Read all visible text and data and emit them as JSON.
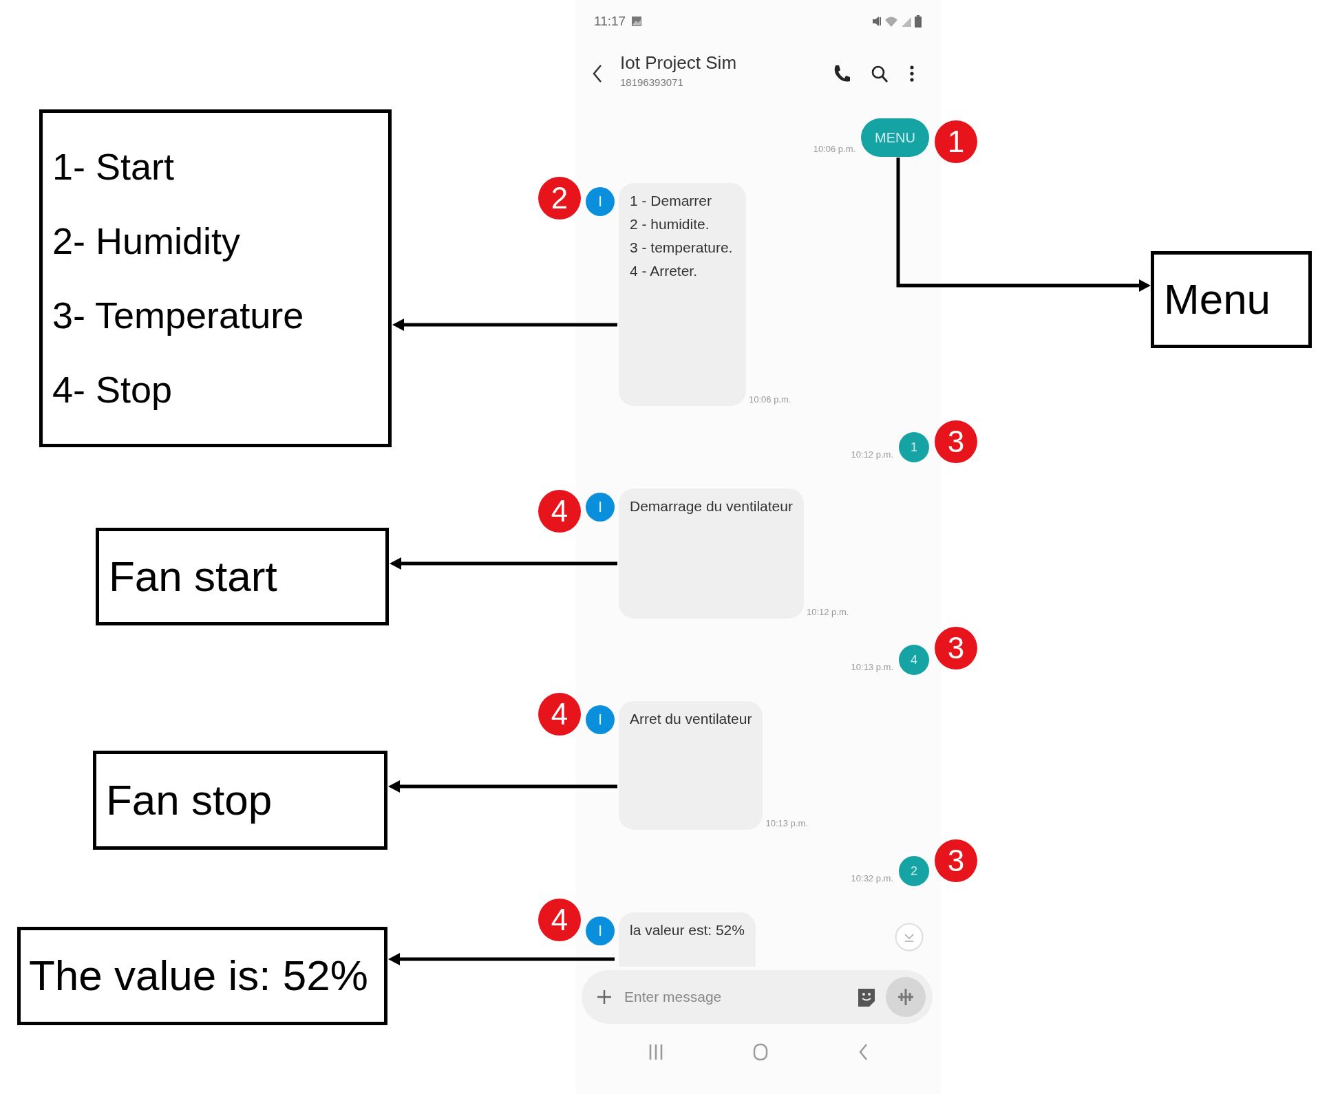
{
  "status_bar": {
    "time": "11:17"
  },
  "conversation": {
    "title": "Iot Project Sim",
    "number": "18196393071"
  },
  "messages": [
    {
      "kind": "sent",
      "text": "MENU",
      "time": "10:06 p.m."
    },
    {
      "kind": "received",
      "avatar": "I",
      "lines": [
        "1 - Demarrer",
        "2 - humidite.",
        "3 - temperature.",
        "4 - Arreter."
      ],
      "time": "10:06 p.m."
    },
    {
      "kind": "sent",
      "text": "1",
      "time": "10:12 p.m."
    },
    {
      "kind": "received",
      "avatar": "I",
      "lines": [
        "Demarrage du ventilateur"
      ],
      "time": "10:12 p.m."
    },
    {
      "kind": "sent",
      "text": "4",
      "time": "10:13 p.m."
    },
    {
      "kind": "received",
      "avatar": "I",
      "lines": [
        "Arret du ventilateur"
      ],
      "time": "10:13 p.m."
    },
    {
      "kind": "sent",
      "text": "2",
      "time": "10:32 p.m."
    },
    {
      "kind": "received",
      "avatar": "I",
      "lines": [
        "la valeur est: 52%"
      ]
    }
  ],
  "composer": {
    "placeholder": "Enter message"
  },
  "annotations": {
    "badges": [
      {
        "label": "1"
      },
      {
        "label": "2"
      },
      {
        "label": "3"
      },
      {
        "label": "4"
      },
      {
        "label": "3"
      },
      {
        "label": "4"
      },
      {
        "label": "3"
      },
      {
        "label": "4"
      }
    ],
    "boxes": [
      {
        "lines": [
          "1- Start",
          "2- Humidity",
          "3- Temperature",
          "4- Stop"
        ]
      },
      {
        "lines": [
          "Menu"
        ]
      },
      {
        "lines": [
          "Fan start"
        ]
      },
      {
        "lines": [
          "Fan stop"
        ]
      },
      {
        "lines": [
          "The value is: 52%"
        ]
      }
    ]
  }
}
